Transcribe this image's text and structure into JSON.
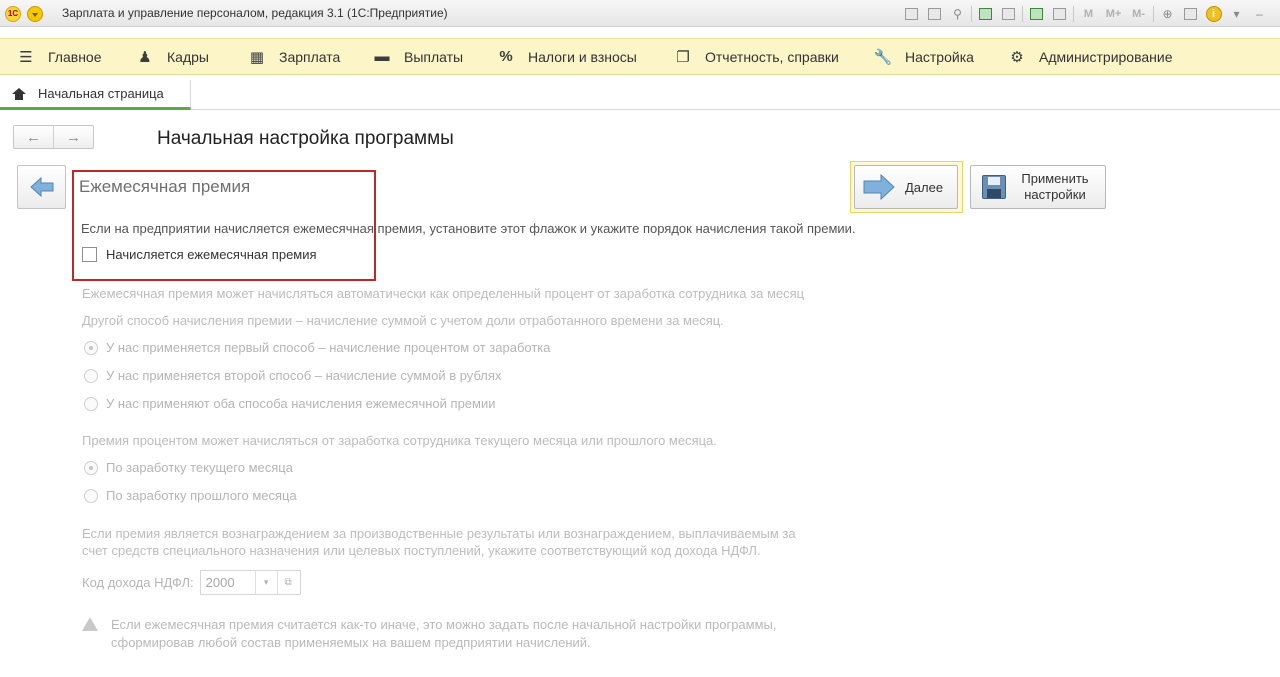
{
  "window": {
    "title": "Зарплата и управление персоналом, редакция 3.1  (1С:Предприятие)",
    "logo_text": "1С",
    "toolbar_text_buttons": [
      "M",
      "M+",
      "M-"
    ]
  },
  "sections": [
    {
      "label": "Главное",
      "icon": "hamburger-menu-icon"
    },
    {
      "label": "Кадры",
      "icon": "people-icon"
    },
    {
      "label": "Зарплата",
      "icon": "calculator-icon"
    },
    {
      "label": "Выплаты",
      "icon": "wallet-icon"
    },
    {
      "label": "Налоги и взносы",
      "icon": "percent-icon"
    },
    {
      "label": "Отчетность, справки",
      "icon": "documents-icon"
    },
    {
      "label": "Настройка",
      "icon": "wrench-icon"
    },
    {
      "label": "Администрирование",
      "icon": "gear-icon"
    }
  ],
  "tabs": {
    "home_label": "Начальная страница"
  },
  "page": {
    "title": "Начальная настройка программы",
    "next_label": "Далее",
    "apply_label": "Применить настройки"
  },
  "form": {
    "section_title": "Ежемесячная премия",
    "description": "Если на предприятии начисляется ежемесячная премия, установите этот флажок и укажите порядок начисления такой премии.",
    "checkbox_label": "Начисляется ежемесячная премия",
    "checkbox_checked": false,
    "method_note_1": "Ежемесячная премия может начисляться автоматически как определенный процент от заработка сотрудника за месяц",
    "method_note_2": "Другой способ начисления премии – начисление суммой с учетом доли отработанного времени за месяц.",
    "method_options": [
      {
        "label": "У нас применяется первый способ – начисление процентом от заработка",
        "selected": true
      },
      {
        "label": "У нас применяется второй способ – начисление суммой в рублях",
        "selected": false
      },
      {
        "label": "У нас применяют оба способа начисления ежемесячной премии",
        "selected": false
      }
    ],
    "base_note": "Премия процентом может начисляться от заработка сотрудника текущего месяца или прошлого месяца.",
    "base_options": [
      {
        "label": "По заработку текущего месяца",
        "selected": true
      },
      {
        "label": "По заработку прошлого месяца",
        "selected": false
      }
    ],
    "ndfl_note_line1": "Если премия является вознаграждением за производственные результаты или вознаграждением, выплачиваемым за",
    "ndfl_note_line2": "счет средств специального назначения или целевых поступлений, укажите соответствующий код дохода НДФЛ.",
    "ndfl_label": "Код дохода НДФЛ:",
    "ndfl_value": "2000",
    "warning_line1": "Если ежемесячная премия считается как-то иначе, это можно задать после начальной настройки программы,",
    "warning_line2": "сформировав любой состав применяемых на вашем предприятии начислений."
  },
  "colors": {
    "section_bar": "#fcf5c8",
    "highlight_frame": "#c0272d",
    "active_tab_underline": "#5ca84a",
    "disabled_text": "#bcbcbc"
  }
}
